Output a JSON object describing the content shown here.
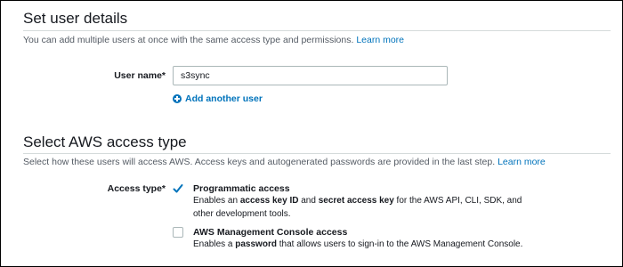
{
  "set_user_details": {
    "title": "Set user details",
    "description": "You can add multiple users at once with the same access type and permissions.",
    "learn_more": "Learn more",
    "user_name_label": "User name*",
    "user_name_value": "s3sync",
    "add_another_user": "Add another user"
  },
  "access_type_section": {
    "title": "Select AWS access type",
    "description": "Select how these users will access AWS. Access keys and autogenerated passwords are provided in the last step.",
    "learn_more": "Learn more",
    "access_type_label": "Access type*",
    "options": [
      {
        "title": "Programmatic access",
        "checked": true,
        "desc_parts": [
          "Enables an ",
          "access key ID",
          " and ",
          "secret access key",
          " for the AWS API, CLI, SDK, and other development tools."
        ]
      },
      {
        "title": "AWS Management Console access",
        "checked": false,
        "desc_parts": [
          "Enables a ",
          "password",
          " that allows users to sign-in to the AWS Management Console."
        ]
      }
    ]
  },
  "colors": {
    "link": "#0073bb",
    "text": "#16191f",
    "muted": "#545b64",
    "rule": "#d5dbdb",
    "input_border": "#aab7b8"
  },
  "icons": {
    "add_user": "plus-circle-icon",
    "checked": "checkmark-icon"
  }
}
